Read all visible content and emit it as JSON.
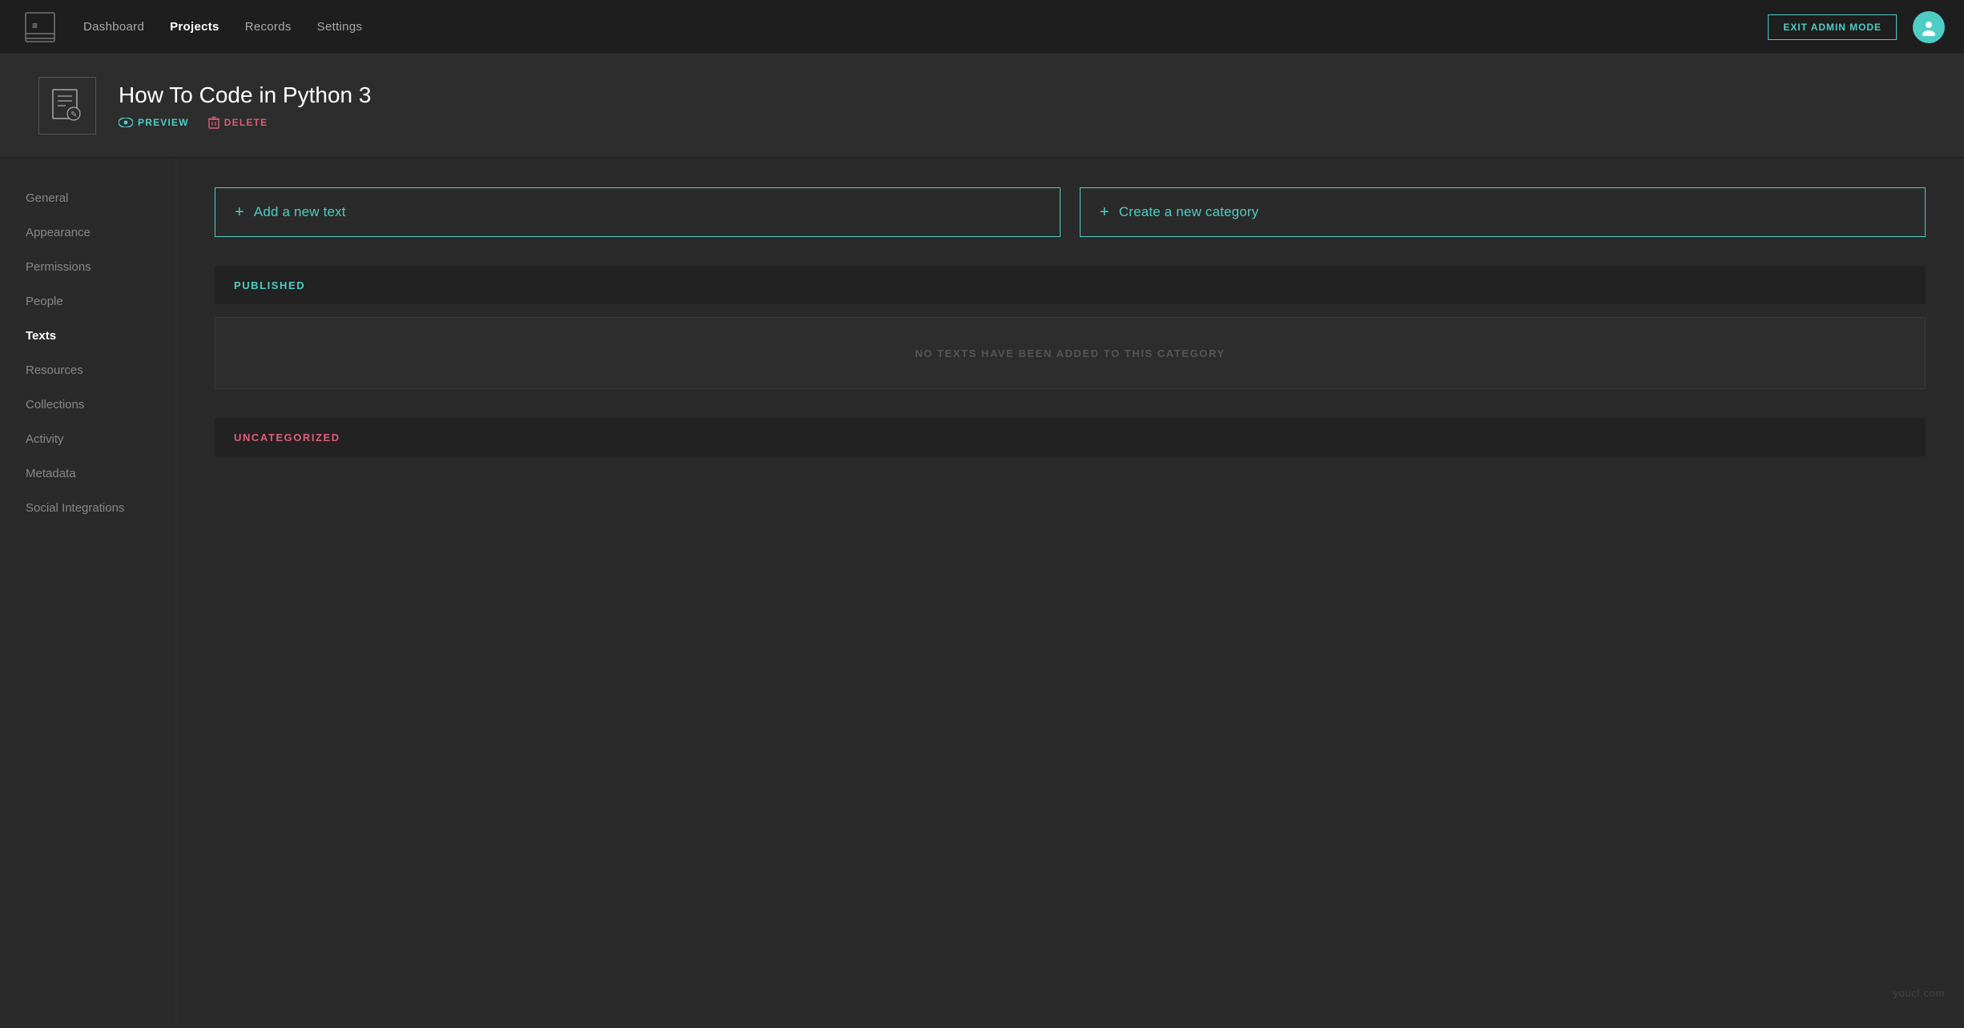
{
  "nav": {
    "links": [
      {
        "label": "Dashboard",
        "active": false
      },
      {
        "label": "Projects",
        "active": true
      },
      {
        "label": "Records",
        "active": false
      },
      {
        "label": "Settings",
        "active": false
      }
    ],
    "exit_admin_label": "EXIT ADMIN MODE"
  },
  "project": {
    "title": "How To Code in Python 3",
    "preview_label": "PREVIEW",
    "delete_label": "DELETE"
  },
  "sidebar": {
    "items": [
      {
        "label": "General",
        "active": false
      },
      {
        "label": "Appearance",
        "active": false
      },
      {
        "label": "Permissions",
        "active": false
      },
      {
        "label": "People",
        "active": false
      },
      {
        "label": "Texts",
        "active": true
      },
      {
        "label": "Resources",
        "active": false
      },
      {
        "label": "Collections",
        "active": false
      },
      {
        "label": "Activity",
        "active": false
      },
      {
        "label": "Metadata",
        "active": false
      },
      {
        "label": "Social Integrations",
        "active": false
      }
    ]
  },
  "main": {
    "add_text_label": "Add a new text",
    "create_category_label": "Create a new category",
    "published_section": {
      "label": "PUBLISHED",
      "empty_message": "NO TEXTS HAVE BEEN ADDED TO THIS CATEGORY"
    },
    "uncategorized_section": {
      "label": "UNCATEGORIZED"
    }
  },
  "footer": {
    "watermark": "youcl.com"
  },
  "colors": {
    "accent": "#4ecdc4",
    "danger": "#e05c7a",
    "bg_dark": "#1e1e1e",
    "bg_mid": "#2d2d2d",
    "bg_light": "#2a2a2a",
    "text_muted": "#888"
  }
}
